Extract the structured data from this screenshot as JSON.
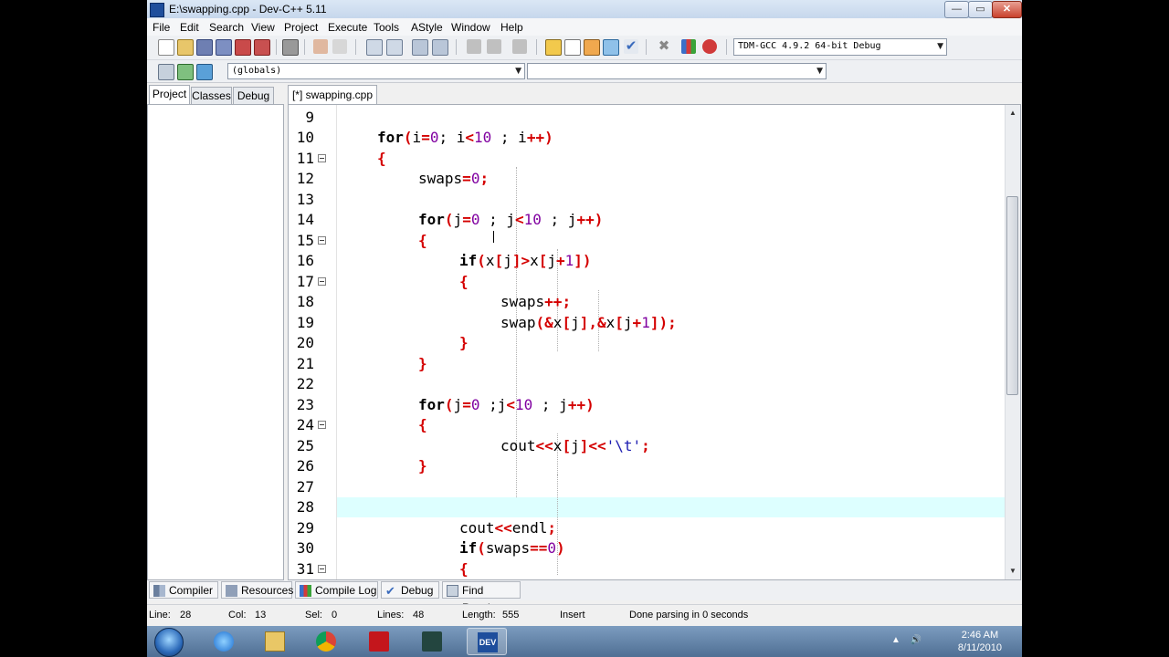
{
  "window": {
    "title": "E:\\swapping.cpp - Dev-C++ 5.11",
    "min": "—",
    "max": "▭",
    "close": "✕"
  },
  "menu": [
    "File",
    "Edit",
    "Search",
    "View",
    "Project",
    "Execute",
    "Tools",
    "AStyle",
    "Window",
    "Help"
  ],
  "toolbar": {
    "compiler_select": "TDM-GCC 4.9.2 64-bit Debug",
    "scope_select": "(globals)",
    "symbol_select": ""
  },
  "left_tabs": [
    "Project",
    "Classes",
    "Debug"
  ],
  "editor_tab": "[*] swapping.cpp",
  "code_lines": [
    {
      "n": "9"
    },
    {
      "n": "10"
    },
    {
      "n": "11"
    },
    {
      "n": "12"
    },
    {
      "n": "13"
    },
    {
      "n": "14"
    },
    {
      "n": "15"
    },
    {
      "n": "16"
    },
    {
      "n": "17"
    },
    {
      "n": "18"
    },
    {
      "n": "19"
    },
    {
      "n": "20"
    },
    {
      "n": "21"
    },
    {
      "n": "22"
    },
    {
      "n": "23"
    },
    {
      "n": "24"
    },
    {
      "n": "25"
    },
    {
      "n": "26"
    },
    {
      "n": "27"
    },
    {
      "n": "28"
    },
    {
      "n": "29"
    },
    {
      "n": "30"
    },
    {
      "n": "31"
    }
  ],
  "code": {
    "l10_kw": "for",
    "l10_a": "(",
    "l10_b": "i",
    "l10_c": "=",
    "l10_d": "0",
    "l10_e": "; i",
    "l10_f": "<",
    "l10_g": "10",
    "l10_h": " ; i",
    "l10_i": "++",
    "l10_j": ")",
    "l11": "{",
    "l12_a": "swaps",
    "l12_b": "=",
    "l12_c": "0",
    "l12_d": ";",
    "l14_kw": "for",
    "l14_a": "(",
    "l14_b": "j",
    "l14_c": "=",
    "l14_d": "0",
    "l14_e": " ; j",
    "l14_f": "<",
    "l14_g": "10",
    "l14_h": " ; j",
    "l14_i": "++",
    "l14_j": ")",
    "l15": "{",
    "l16_kw": "if",
    "l16_a": "(",
    "l16_b": "x",
    "l16_c": "[",
    "l16_d": "j",
    "l16_e": "]>",
    "l16_f": "x",
    "l16_g": "[",
    "l16_h": "j",
    "l16_i": "+",
    "l16_j": "1",
    "l16_k": "])",
    "l17": "{",
    "l18_a": "swaps",
    "l18_b": "++;",
    "l19_a": "swap",
    "l19_b": "(&",
    "l19_c": "x",
    "l19_d": "[",
    "l19_e": "j",
    "l19_f": "],&",
    "l19_g": "x",
    "l19_h": "[",
    "l19_i": "j",
    "l19_j": "+",
    "l19_k": "1",
    "l19_l": "]);",
    "l20": "}",
    "l21": "}",
    "l23_kw": "for",
    "l23_a": "(",
    "l23_b": "j",
    "l23_c": "=",
    "l23_d": "0",
    "l23_e": " ;j",
    "l23_f": "<",
    "l23_g": "10",
    "l23_h": " ; j",
    "l23_i": "++",
    "l23_j": ")",
    "l24": "{",
    "l25_a": "cout",
    "l25_b": "<<",
    "l25_c": "x",
    "l25_d": "[",
    "l25_e": "j",
    "l25_f": "]<<",
    "l25_g": "'\\t'",
    "l25_h": ";",
    "l26": "}",
    "l29_a": "cout",
    "l29_b": "<<",
    "l29_c": "endl",
    "l29_d": ";",
    "l30_kw": "if",
    "l30_a": "(",
    "l30_b": "swaps",
    "l30_c": "==",
    "l30_d": "0",
    "l30_e": ")",
    "l31": "{"
  },
  "bottom_tabs": [
    "Compiler",
    "Resources",
    "Compile Log",
    "Debug",
    "Find Results"
  ],
  "status": {
    "line_label": "Line:",
    "line_val": "28",
    "col_label": "Col:",
    "col_val": "13",
    "sel_label": "Sel:",
    "sel_val": "0",
    "lines_label": "Lines:",
    "lines_val": "48",
    "length_label": "Length:",
    "length_val": "555",
    "mode": "Insert",
    "message": "Done parsing in 0 seconds"
  },
  "taskbar": {
    "time": "2:46 AM",
    "date": "8/11/2010",
    "tray_arrow": "▲",
    "tray_volume": "🔊",
    "dev_label": "DEV"
  },
  "colors": {
    "keyword": "#000000",
    "operator": "#d40000",
    "number": "#8000a0",
    "current_line": "#ddffff"
  }
}
